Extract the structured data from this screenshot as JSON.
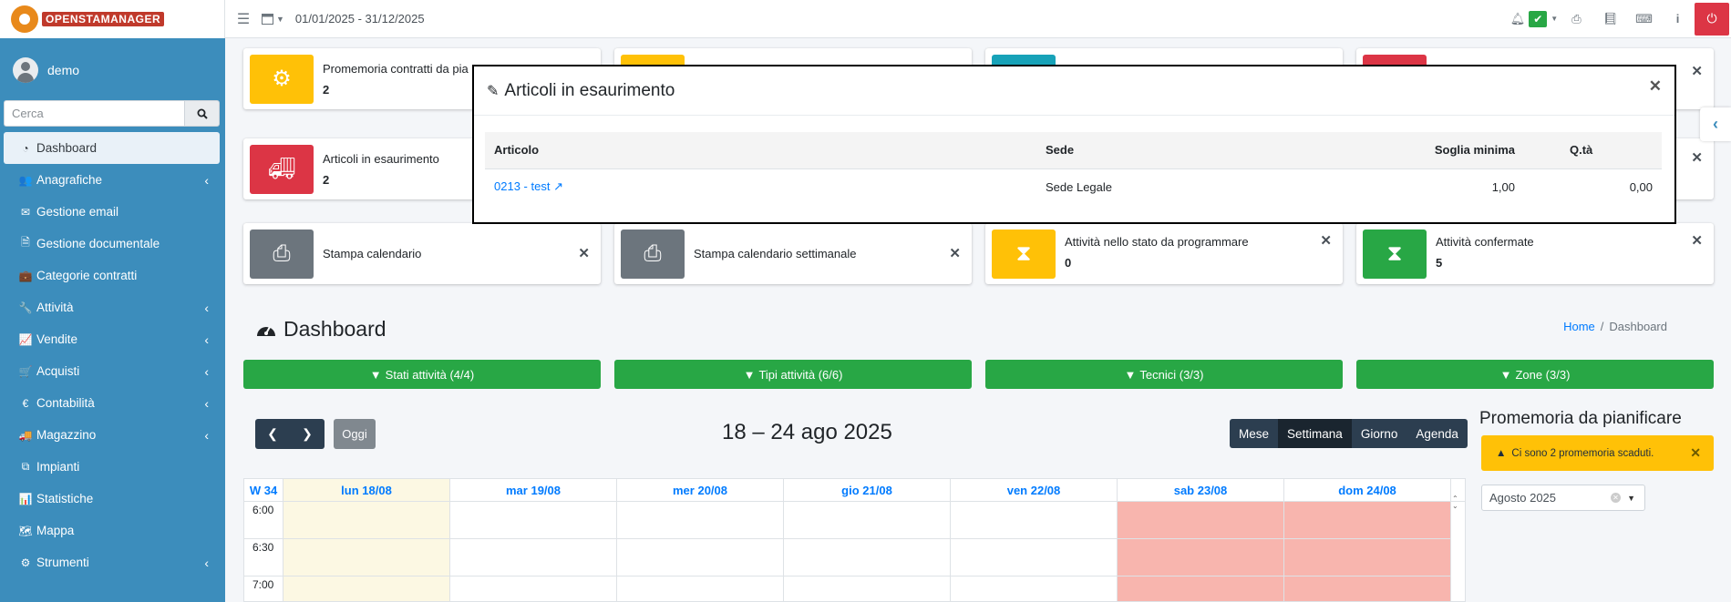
{
  "brand": {
    "name": "OPENSTAMANAGER"
  },
  "user": {
    "name": "demo"
  },
  "search": {
    "placeholder": "Cerca"
  },
  "sidebar": {
    "items": [
      {
        "label": "Dashboard",
        "icon": "tachometer-icon",
        "glyph": "◔",
        "active": true,
        "chevron": false
      },
      {
        "label": "Anagrafiche",
        "icon": "users-icon",
        "glyph": "👥",
        "chevron": true
      },
      {
        "label": "Gestione email",
        "icon": "envelope-icon",
        "glyph": "✉",
        "chevron": false
      },
      {
        "label": "Gestione documentale",
        "icon": "file-icon",
        "glyph": "🗎",
        "chevron": false
      },
      {
        "label": "Categorie contratti",
        "icon": "briefcase-icon",
        "glyph": "💼",
        "chevron": false
      },
      {
        "label": "Attività",
        "icon": "wrench-icon",
        "glyph": "🔧",
        "chevron": true
      },
      {
        "label": "Vendite",
        "icon": "line-chart-icon",
        "glyph": "📈",
        "chevron": true
      },
      {
        "label": "Acquisti",
        "icon": "shopping-cart-icon",
        "glyph": "🛒",
        "chevron": true
      },
      {
        "label": "Contabilità",
        "icon": "euro-icon",
        "glyph": "€",
        "chevron": true
      },
      {
        "label": "Magazzino",
        "icon": "truck-icon",
        "glyph": "🚚",
        "chevron": true
      },
      {
        "label": "Impianti",
        "icon": "sitemap-icon",
        "glyph": "⧉",
        "chevron": false
      },
      {
        "label": "Statistiche",
        "icon": "bar-chart-icon",
        "glyph": "📊",
        "chevron": false
      },
      {
        "label": "Mappa",
        "icon": "map-icon",
        "glyph": "🗺",
        "chevron": false
      },
      {
        "label": "Strumenti",
        "icon": "cog-icon",
        "glyph": "⚙",
        "chevron": true
      }
    ]
  },
  "topbar": {
    "period": "01/01/2025 - 31/12/2025"
  },
  "infoboxes": [
    {
      "label": "Promemoria contratti da pia",
      "value": "2",
      "color": "#ffc107",
      "icon": "cog-icon"
    },
    {
      "label": "Articoli in esaurimento",
      "value": "2",
      "color": "#dc3545",
      "icon": "truck-icon"
    },
    {
      "label": "Stampa calendario",
      "value": "",
      "color": "#6c757d",
      "icon": "print-icon"
    },
    {
      "label": "Stampa calendario settimanale",
      "value": "",
      "color": "#6c757d",
      "icon": "print-icon"
    },
    {
      "label": "Attività nello stato da programmare",
      "value": "0",
      "color": "#ffc107",
      "icon": "hourglass-icon"
    },
    {
      "label": "Attività confermate",
      "value": "5",
      "color": "#28a745",
      "icon": "hourglass-icon"
    }
  ],
  "page": {
    "title": "Dashboard"
  },
  "breadcrumb": {
    "home": "Home",
    "separator": "/",
    "current": "Dashboard"
  },
  "filters": [
    {
      "label": "Stati attività (4/4)"
    },
    {
      "label": "Tipi attività (6/6)"
    },
    {
      "label": "Tecnici (3/3)"
    },
    {
      "label": "Zone (3/3)"
    }
  ],
  "calendar": {
    "today_label": "Oggi",
    "title": "18 – 24 ago 2025",
    "views": [
      "Mese",
      "Settimana",
      "Giorno",
      "Agenda"
    ],
    "active_view": "Settimana",
    "week_label": "W 34",
    "days": [
      "lun 18/08",
      "mar 19/08",
      "mer 20/08",
      "gio 21/08",
      "ven 22/08",
      "sab 23/08",
      "dom 24/08"
    ],
    "times": [
      "6:00",
      "6:30",
      "7:00"
    ]
  },
  "reminders": {
    "title": "Promemoria da pianificare",
    "alert": "Ci sono 2 promemoria scaduti.",
    "month_select": "Agosto 2025"
  },
  "modal": {
    "title": "Articoli in esaurimento",
    "columns": [
      "Articolo",
      "Sede",
      "Soglia minima",
      "Q.tà"
    ],
    "rows": [
      {
        "articolo": "0213 - test",
        "sede": "Sede Legale",
        "soglia": "1,00",
        "qta": "0,00"
      }
    ]
  },
  "colors": {
    "sidebar": "#3c8dbc",
    "success": "#28a745",
    "danger": "#dc3545",
    "warning": "#ffc107",
    "dark": "#2c3e50"
  }
}
